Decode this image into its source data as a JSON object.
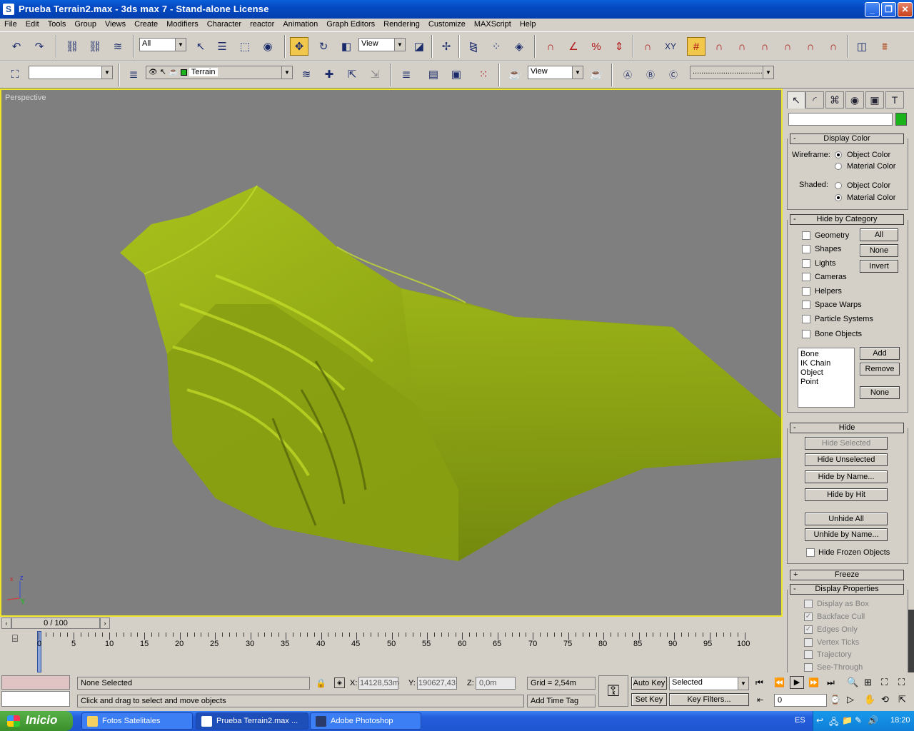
{
  "window": {
    "title": "Prueba Terrain2.max  - 3ds max 7  - Stand-alone License",
    "minimize": "_",
    "maximize": "❐",
    "close": "✕"
  },
  "menu": [
    "File",
    "Edit",
    "Tools",
    "Group",
    "Views",
    "Create",
    "Modifiers",
    "Character",
    "reactor",
    "Animation",
    "Graph Editors",
    "Rendering",
    "Customize",
    "MAXScript",
    "Help"
  ],
  "toolbar": {
    "selection_filter": "All",
    "reference_coord": "View",
    "layer_name": "Terrain",
    "render_view": "View",
    "render_preset": "................................"
  },
  "viewport": {
    "label": "Perspective",
    "axis_z": "z",
    "axis_x": "x",
    "axis_y": "y",
    "terrain_color": "#9aae14",
    "background": "#7f7f7f",
    "border_color": "#f0e628"
  },
  "command_panel": {
    "name_field": "",
    "object_color": "#1bb31b",
    "display_color": {
      "title": "Display Color",
      "wireframe_label": "Wireframe:",
      "shaded_label": "Shaded:",
      "object_color": "Object Color",
      "material_color": "Material Color"
    },
    "hide_by_category": {
      "title": "Hide by Category",
      "items": [
        "Geometry",
        "Shapes",
        "Lights",
        "Cameras",
        "Helpers",
        "Space Warps",
        "Particle Systems",
        "Bone Objects"
      ],
      "btn_all": "All",
      "btn_none": "None",
      "btn_invert": "Invert",
      "list": [
        "Bone",
        "IK Chain Object",
        "Point"
      ],
      "btn_add": "Add",
      "btn_remove": "Remove",
      "btn_none2": "None"
    },
    "hide": {
      "title": "Hide",
      "hide_selected": "Hide Selected",
      "hide_unselected": "Hide Unselected",
      "hide_by_name": "Hide by Name...",
      "hide_by_hit": "Hide by Hit",
      "unhide_all": "Unhide All",
      "unhide_by_name": "Unhide by Name...",
      "hide_frozen": "Hide Frozen Objects"
    },
    "freeze": {
      "title": "Freeze"
    },
    "display_properties": {
      "title": "Display Properties",
      "items": [
        "Display as Box",
        "Backface Cull",
        "Edges Only",
        "Vertex Ticks",
        "Trajectory",
        "See-Through"
      ]
    }
  },
  "timeline": {
    "frame_display": "0 / 100",
    "ticks": [
      "0",
      "5",
      "10",
      "15",
      "20",
      "25",
      "30",
      "35",
      "40",
      "45",
      "50",
      "55",
      "60",
      "65",
      "70",
      "75",
      "80",
      "85",
      "90",
      "95",
      "100"
    ]
  },
  "status": {
    "selection": "None Selected",
    "prompt": "Click and drag to select and move objects",
    "x_label": "X:",
    "x_value": "14128,53m",
    "y_label": "Y:",
    "y_value": "190627,43",
    "z_label": "Z:",
    "z_value": "0,0m",
    "grid": "Grid = 2,54m",
    "add_time_tag": "Add Time Tag",
    "auto_key": "Auto Key",
    "set_key": "Set Key",
    "key_mode": "Selected",
    "key_filters": "Key Filters...",
    "current_frame": "0"
  },
  "taskbar": {
    "start": "Inicio",
    "tasks": [
      "Fotos Satelitales",
      "Prueba Terrain2.max ...",
      "Adobe Photoshop"
    ],
    "lang": "ES",
    "clock": "18:20"
  }
}
